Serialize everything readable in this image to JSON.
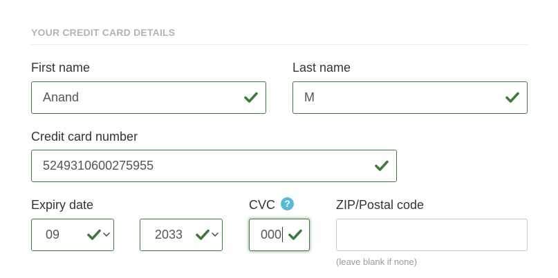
{
  "section": {
    "title": "YOUR CREDIT CARD DETAILS"
  },
  "first_name": {
    "label": "First name",
    "value": "Anand",
    "status_icon": "checkmark-icon"
  },
  "last_name": {
    "label": "Last name",
    "value": "M",
    "status_icon": "checkmark-icon"
  },
  "card_number": {
    "label": "Credit card number",
    "value": "5249310600275955",
    "status_icon": "checkmark-icon"
  },
  "expiry": {
    "label": "Expiry date",
    "month": "09",
    "year": "2033",
    "status_icon": "checkmark-icon",
    "dropdown_icon": "chevron-down-icon"
  },
  "cvc": {
    "label": "CVC",
    "help_glyph": "?",
    "help_icon": "question-mark-icon",
    "value": "000",
    "status_icon": "checkmark-icon"
  },
  "zip": {
    "label": "ZIP/Postal code",
    "value": "",
    "hint": "(leave blank if none)"
  },
  "colors": {
    "valid_border": "#3d7a3d",
    "checkmark": "#3d7a3d",
    "help_icon": "#5bb8d9",
    "section_title": "#b3b3b3"
  }
}
